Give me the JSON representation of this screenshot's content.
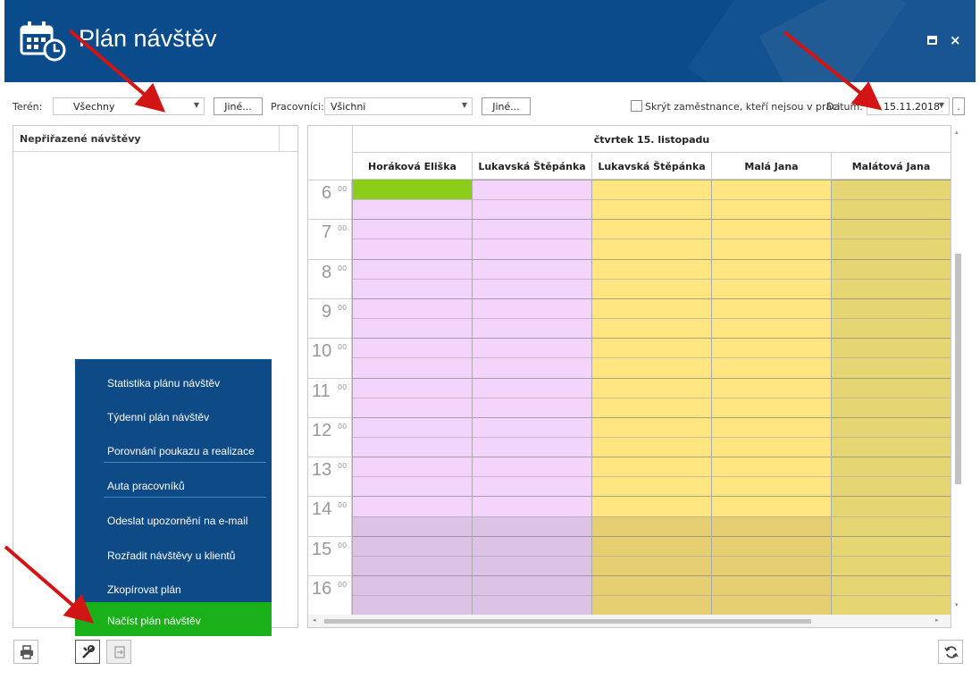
{
  "header": {
    "title": "Plán návštěv",
    "icon": "calendar-clock-icon",
    "window_controls": [
      "maximize-icon",
      "close-icon"
    ],
    "close_glyph": "×"
  },
  "toolbar": {
    "teren_label": "Terén:",
    "teren_value": "Všechny",
    "jine1_label": "Jiné...",
    "pracovnici_label": "Pracovníci:",
    "pracovnici_value": "Všichni",
    "jine2_label": "Jiné...",
    "skryt_label": "Skrýt zaměstnance, kteří nejsou v práci",
    "datum_label": "Datum:",
    "datum_value": "15.11.2018",
    "dot_button": "."
  },
  "left_panel": {
    "header": "Nepřiřazené návštěvy"
  },
  "calendar": {
    "day_header": "čtvrtek 15. listopadu",
    "resources": [
      {
        "name": "Horáková Eliška",
        "color": "#f3d4fb",
        "off_color": "#dcc2e4"
      },
      {
        "name": "Lukavská Štěpánka",
        "color": "#f3d4fb",
        "off_color": "#dcc2e4"
      },
      {
        "name": "Lukavská Štěpánka",
        "color": "#ffe680",
        "off_color": "#e6cf73"
      },
      {
        "name": "Malá Jana",
        "color": "#ffe680",
        "off_color": "#e6cf73"
      },
      {
        "name": "Malátová Jana",
        "color": "#e6d573",
        "off_color": "#e6d573"
      }
    ],
    "hours": [
      "6",
      "7",
      "8",
      "9",
      "10",
      "11",
      "12",
      "13",
      "14",
      "15",
      "16"
    ],
    "minutes_label": "00",
    "event_color": "#8ccd1a"
  },
  "menu": {
    "items": [
      "Statistika plánu návštěv",
      "Týdenní plán návštěv",
      "Porovnání poukazu a realizace",
      "Auta pracovníků",
      "Odeslat upozornění na e-mail",
      "Rozřadit návštěvy u klientů",
      "Zkopírovat plán",
      "Načíst plán návštěv"
    ],
    "active_index": 7,
    "bg_color": "#0d4a86",
    "active_color": "#1ab01a"
  },
  "bottom": {
    "icons": [
      "print-icon",
      "tools-icon",
      "export-icon",
      "refresh-icon"
    ]
  },
  "colors": {
    "header_bg": "#0a4b8c",
    "arrow": "#d21414"
  }
}
